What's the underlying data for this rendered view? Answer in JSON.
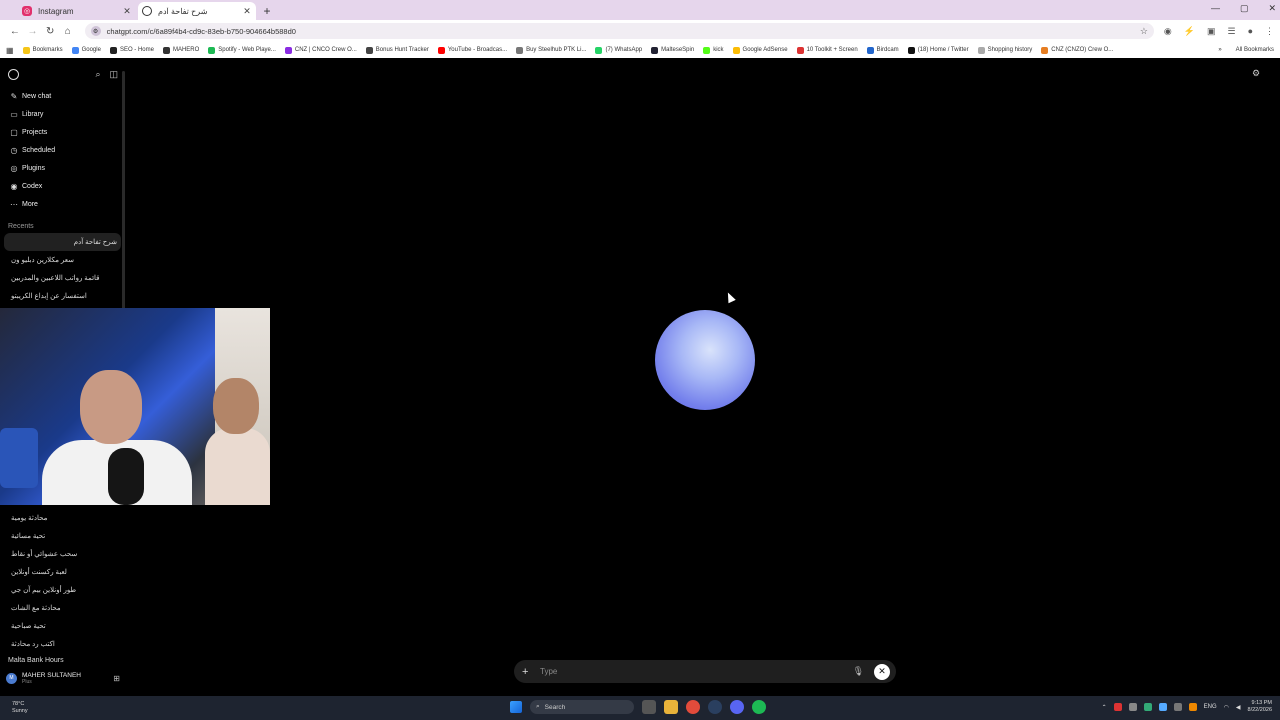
{
  "browser": {
    "tabs": [
      {
        "title": "Instagram",
        "icon": "instagram-icon",
        "active": false
      },
      {
        "title": "شرح تفاحة آدم",
        "icon": "chatgpt-icon",
        "active": true
      }
    ],
    "url": "chatgpt.com/c/6a89f4b4-cd9c-83eb-b750-904664b588d0",
    "bookmarks": [
      "Bookmarks",
      "Google",
      "SEO - Home",
      "MAHERO",
      "Spotify - Web Playe...",
      "CNZ | CNCO Crew O...",
      "Bonus Hunt Tracker",
      "YouTube - Broadcas...",
      "Buy Steelhub PTK Li...",
      "(7) WhatsApp",
      "MalteseSpin",
      "kick",
      "Google AdSense",
      "10 Toolkit + Screen",
      "Birdcam",
      "(18) Home / Twitter",
      "Shopping history",
      "CNZ (CNZO) Crew O..."
    ],
    "all_bookmarks": "All Bookmarks"
  },
  "sidebar": {
    "nav": [
      {
        "label": "New chat",
        "icon": "edit-icon"
      },
      {
        "label": "Library",
        "icon": "image-icon"
      },
      {
        "label": "Projects",
        "icon": "folder-icon"
      },
      {
        "label": "Scheduled",
        "icon": "clock-icon"
      },
      {
        "label": "Plugins",
        "icon": "plugin-icon"
      },
      {
        "label": "Codex",
        "icon": "codex-icon"
      },
      {
        "label": "More",
        "icon": "more-icon"
      }
    ],
    "recents_label": "Recents",
    "recents_top": [
      "شرح تفاحة آدم",
      "سعر مكلارين دبليو ون",
      "قائمة رواتب اللاعبين والمدربين",
      "استفسار عن إبداع الكريبتو"
    ],
    "recents_bottom": [
      "محادثة يومية",
      "تحية مسائية",
      "سحب عشوائي أو نقاط",
      "لعبة ركسنت أونلاين",
      "طور أونلاين بيم آن جي",
      "محادثة مع الشات",
      "تحية صباحية",
      "اكتب رد محادثة",
      "Malta Bank Hours"
    ],
    "user": {
      "name": "MAHER SULTANEH",
      "plan": "Plus",
      "initials": "M"
    }
  },
  "composer": {
    "placeholder": "Type"
  },
  "taskbar": {
    "weather_temp": "78°C",
    "weather_desc": "Sunny",
    "search_label": "Search",
    "lang": "ENG",
    "time": "9:13 PM",
    "date": "8/22/2026"
  },
  "colors": {
    "orb": "#7480ec",
    "accent": "#4a7bd0"
  }
}
